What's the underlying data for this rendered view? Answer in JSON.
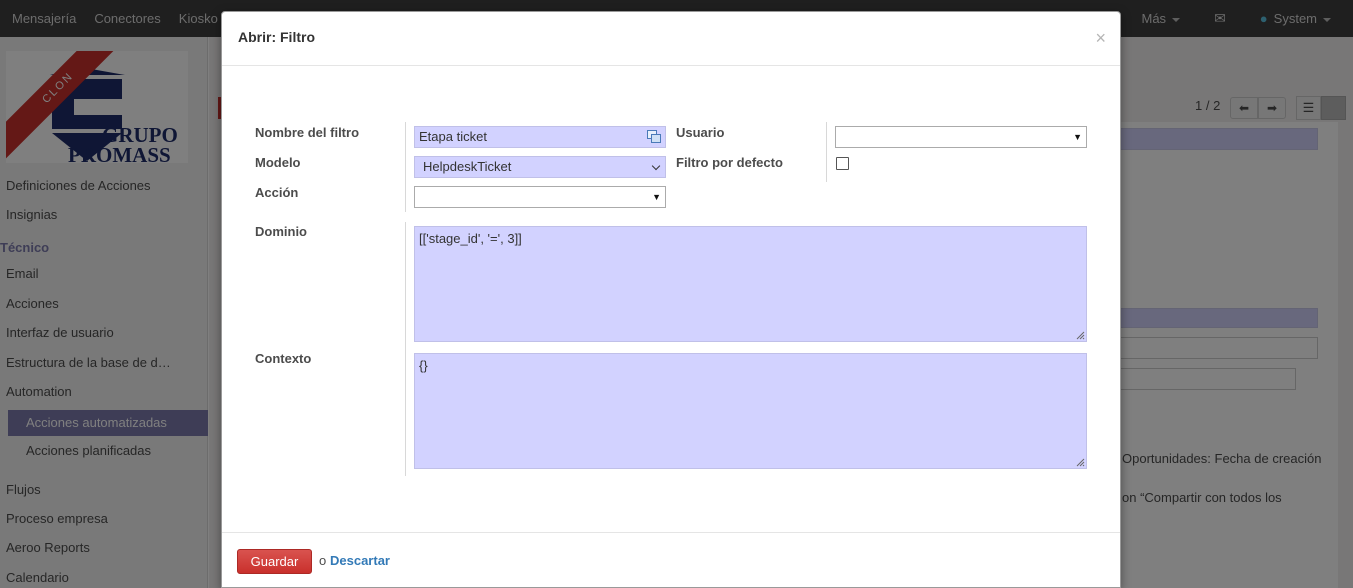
{
  "topbar": {
    "menu": [
      "Mensajería",
      "Conectores",
      "Kiosko"
    ],
    "more_label": "Más",
    "user_label": "System"
  },
  "sidebar": {
    "logo_ribbon": "CLON",
    "logo_line1": "GRUPO",
    "logo_line2": "PROMASS",
    "items_top": [
      "Definiciones de Acciones",
      "Insignias"
    ],
    "section": "Técnico",
    "items": [
      "Email",
      "Acciones",
      "Interfaz de usuario",
      "Estructura de la base de d…",
      "Automation"
    ],
    "subitems": [
      "Acciones automatizadas",
      "Acciones planificadas"
    ],
    "items_bottom": [
      "Flujos",
      "Proceso empresa",
      "Aeroo Reports",
      "Calendario"
    ]
  },
  "background": {
    "pager": "1 / 2",
    "text1": "Oportunidades: Fecha de creación",
    "text2": "on “Compartir con todos los"
  },
  "modal": {
    "title": "Abrir: Filtro",
    "close": "×",
    "fields": {
      "name_label": "Nombre del filtro",
      "name_value": "Etapa ticket",
      "model_label": "Modelo",
      "model_value": "HelpdeskTicket",
      "action_label": "Acción",
      "action_value": "",
      "user_label": "Usuario",
      "user_value": "",
      "default_label": "Filtro por defecto",
      "default_checked": false,
      "domain_label": "Dominio",
      "domain_value": "[['stage_id', '=', 3]]",
      "context_label": "Contexto",
      "context_value": "{}"
    },
    "footer": {
      "save_label": "Guardar",
      "or_label": "o",
      "discard_label": "Descartar"
    }
  }
}
